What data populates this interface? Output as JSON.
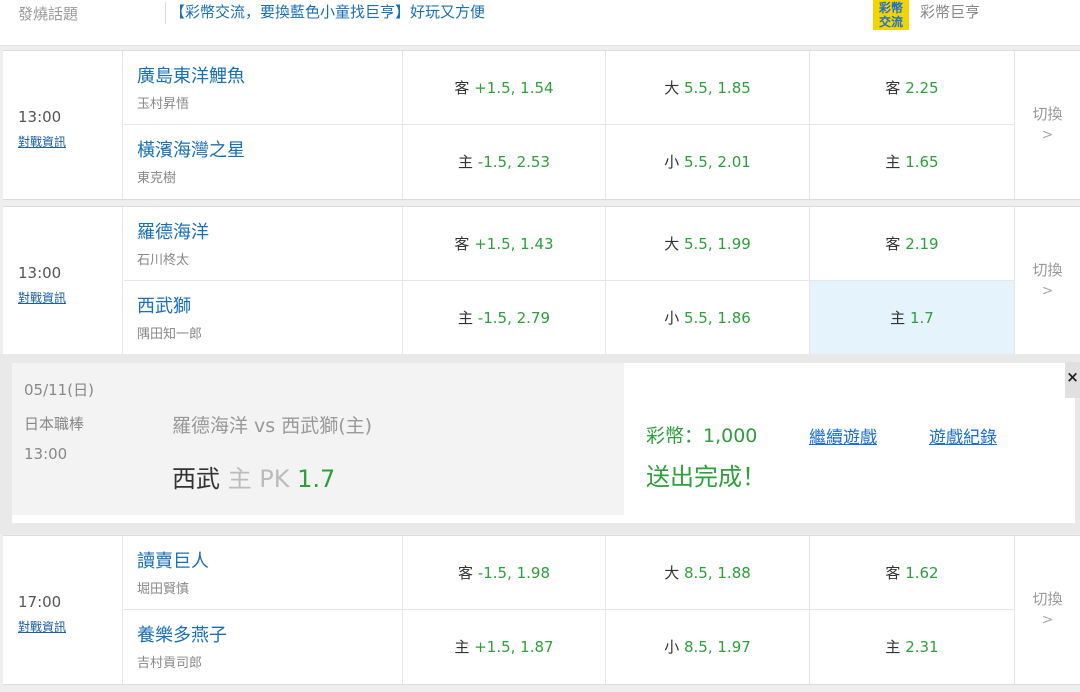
{
  "topbar": {
    "label": "發燒話題",
    "promo": "【彩幣交流，要換藍色小童找巨亨】好玩又方便",
    "badge_line1": "彩幣",
    "badge_line2": "交流",
    "badge_label": "彩幣巨亨"
  },
  "common": {
    "info": "對戰資訊",
    "switch": "切換",
    "arrow": ">"
  },
  "matches": [
    {
      "time": "13:00",
      "team1": {
        "name": "廣島東洋鯉魚",
        "pitcher": "玉村昇悟"
      },
      "team2": {
        "name": "橫濱海灣之星",
        "pitcher": "東克樹"
      },
      "r1": {
        "spread_label": "客",
        "spread": "+1.5, 1.54",
        "total_label": "大",
        "total": "5.5, 1.85",
        "ml_label": "客",
        "ml": "2.25"
      },
      "r2": {
        "spread_label": "主",
        "spread": "-1.5, 2.53",
        "total_label": "小",
        "total": "5.5, 2.01",
        "ml_label": "主",
        "ml": "1.65"
      }
    },
    {
      "time": "13:00",
      "team1": {
        "name": "羅德海洋",
        "pitcher": "石川柊太"
      },
      "team2": {
        "name": "西武獅",
        "pitcher": "隅田知一郎"
      },
      "r1": {
        "spread_label": "客",
        "spread": "+1.5, 1.43",
        "total_label": "大",
        "total": "5.5, 1.99",
        "ml_label": "客",
        "ml": "2.19"
      },
      "r2": {
        "spread_label": "主",
        "spread": "-1.5, 2.79",
        "total_label": "小",
        "total": "5.5, 1.86",
        "ml_label": "主",
        "ml": "1.7"
      }
    },
    {
      "time": "17:00",
      "team1": {
        "name": "讀賣巨人",
        "pitcher": "堀田賢慎"
      },
      "team2": {
        "name": "養樂多燕子",
        "pitcher": "吉村貢司郎"
      },
      "r1": {
        "spread_label": "客",
        "spread": "-1.5, 1.98",
        "total_label": "大",
        "total": "8.5, 1.88",
        "ml_label": "客",
        "ml": "1.62"
      },
      "r2": {
        "spread_label": "主",
        "spread": "+1.5, 1.87",
        "total_label": "小",
        "total": "8.5, 1.97",
        "ml_label": "主",
        "ml": "2.31"
      }
    }
  ],
  "confirm": {
    "date": "05/11(日)",
    "league": "日本職棒",
    "time": "13:00",
    "matchup": "羅德海洋 vs 西武獅(主)",
    "bet_team": "西武",
    "bet_side": "主",
    "bet_type": "PK",
    "bet_odds": "1.7",
    "coins": "彩幣：1,000",
    "done": "送出完成！",
    "continue": "繼續遊戲",
    "history": "遊戲紀錄",
    "close": "×"
  },
  "colors": {
    "odds_green": "#2e9f3a",
    "link_blue": "#1a6fb5",
    "selected_bg": "#e4f3fc",
    "badge_yellow": "#f2d400"
  }
}
